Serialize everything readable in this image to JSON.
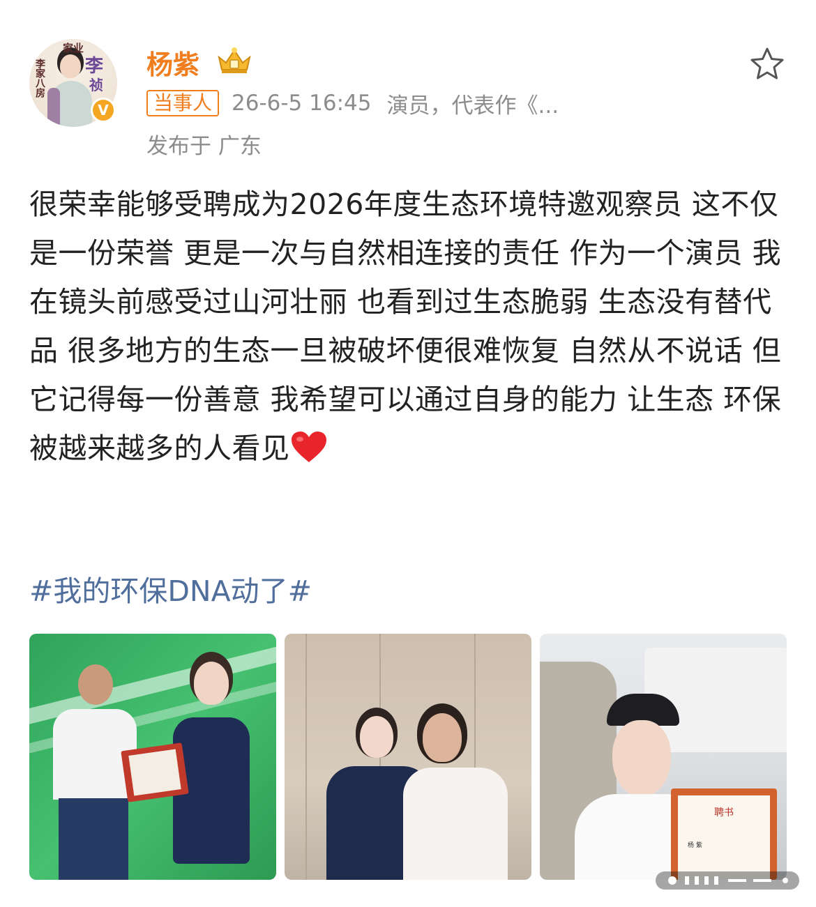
{
  "post": {
    "avatar_text": {
      "line1": "家业",
      "line2": "李家八房",
      "line3": "李",
      "line4": "祯"
    },
    "username": "杨紫",
    "tag": "当事人",
    "time": "26-6-5 16:45",
    "source": "演员，代表作《...",
    "location": "发布于 广东",
    "text": "很荣幸能够受聘成为2026年度生态环境特邀观察员 这不仅是一份荣誉 更是一次与自然相连接的责任 作为一个演员 我在镜头前感受过山河壮丽 也看到过生态脆弱 生态没有替代品 很多地方的生态一旦被破坏便很难恢复 自然从不说话 但它记得每一份善意 我希望可以通过自身的能力 让生态 环保被越来越多的人看见",
    "hashtag": "#我的环保DNA动了#",
    "photo3_certificate_title": "聘书",
    "photo3_certificate_name": "杨 紫"
  },
  "icons": {
    "verified": "verified-badge-icon",
    "crown": "crown-icon",
    "favorite": "star-icon",
    "heart": "heart-emoji-icon"
  },
  "colors": {
    "username": "#f07e1e",
    "hashtag": "#4f6e9c",
    "meta": "#8c8c8c",
    "verified": "#f5a623"
  }
}
